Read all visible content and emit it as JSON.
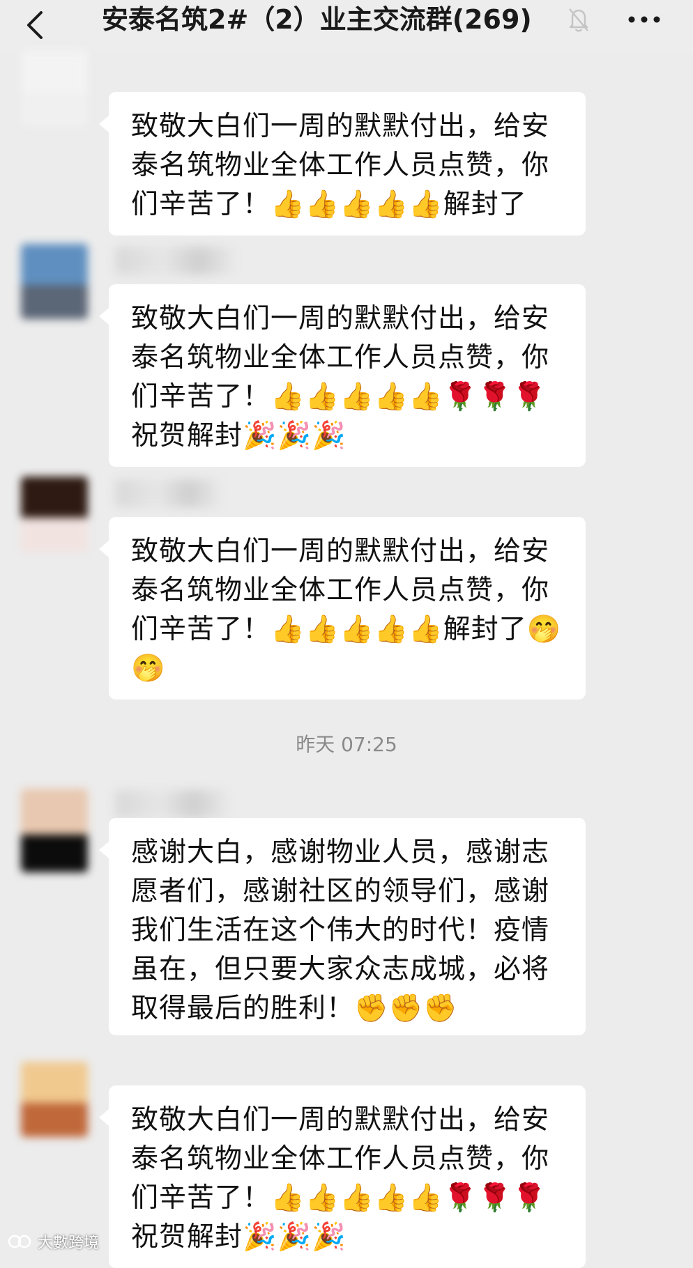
{
  "header": {
    "title": "安泰名筑2#（2）业主交流群(269)",
    "back_icon": "chevron-left-icon",
    "mute_icon": "bell-off-icon",
    "more_icon": "more-dots-icon"
  },
  "messages": [
    {
      "text": "致敬大白们一周的默默付出，给安泰名筑物业全体工作人员点赞，你们辛苦了！👍👍👍👍👍解封了"
    },
    {
      "text": "致敬大白们一周的默默付出，给安泰名筑物业全体工作人员点赞，你们辛苦了！👍👍👍👍👍🌹🌹🌹祝贺解封🎉🎉🎉"
    },
    {
      "text": "致敬大白们一周的默默付出，给安泰名筑物业全体工作人员点赞，你们辛苦了！👍👍👍👍👍解封了🤭🤭"
    },
    {
      "text": "感谢大白，感谢物业人员，感谢志愿者们，感谢社区的领导们，感谢我们生活在这个伟大的时代！疫情虽在，但只要大家众志成城，必将取得最后的胜利！✊✊✊"
    },
    {
      "text": "致敬大白们一周的默默付出，给安泰名筑物业全体工作人员点赞，你们辛苦了！👍👍👍👍👍🌹🌹🌹祝贺解封🎉🎉🎉"
    }
  ],
  "timestamp": "昨天 07:25",
  "watermark": "大數跨境",
  "colors": {
    "background": "#ececec",
    "bubble": "#ffffff",
    "text": "#111111",
    "timestamp": "#8a8a8a"
  }
}
